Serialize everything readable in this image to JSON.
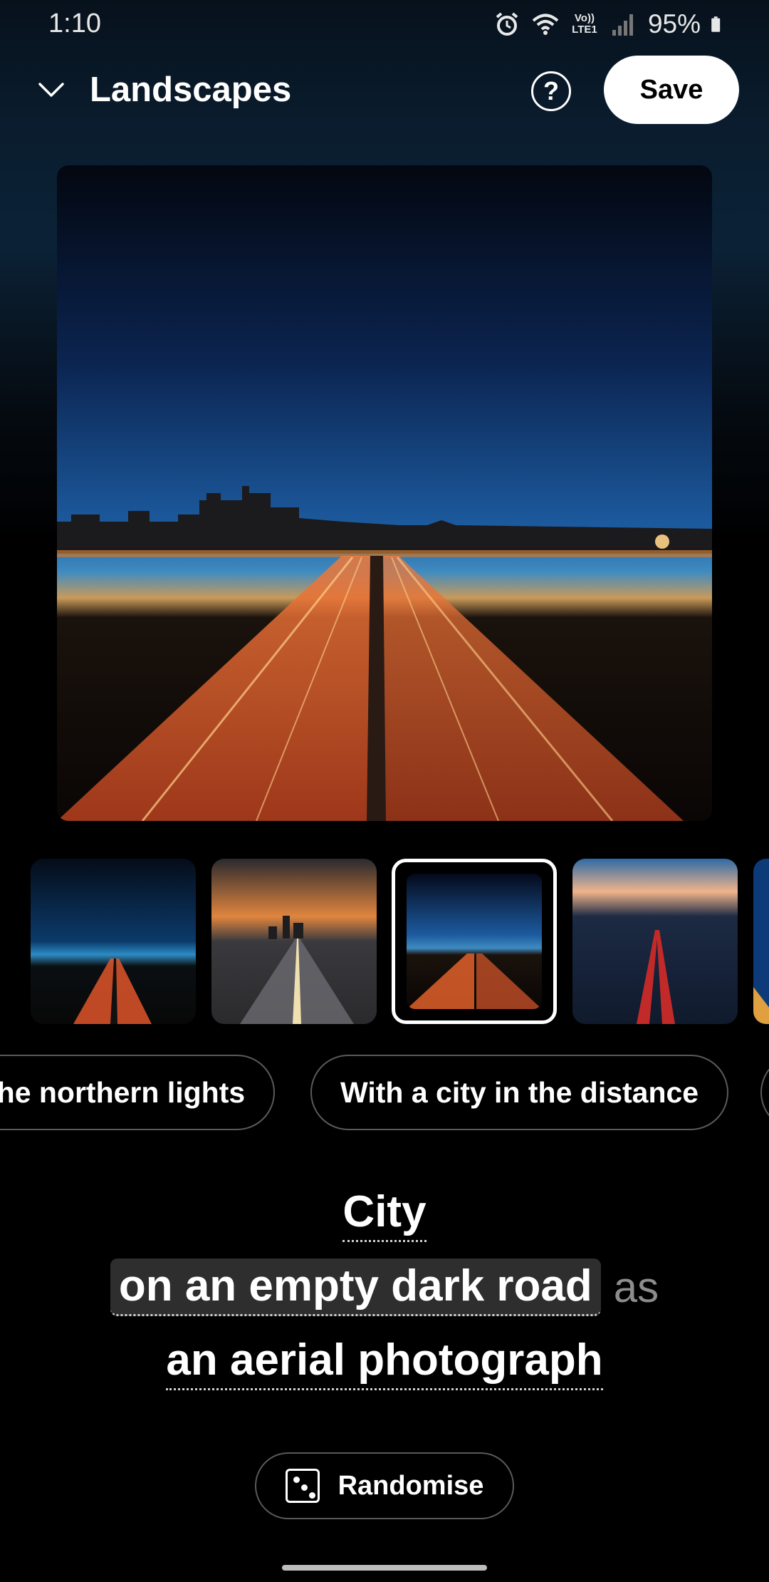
{
  "status_bar": {
    "time": "1:10",
    "network_label": "Vo)) LTE1",
    "battery": "95%",
    "icons": [
      "alarm-icon",
      "wifi-icon",
      "volte-icon",
      "signal-icon",
      "battery-icon"
    ]
  },
  "header": {
    "collapse_icon": "chevron-down-icon",
    "title": "Landscapes",
    "help_label": "?",
    "save_label": "Save"
  },
  "thumbnails": {
    "count_visible": 5,
    "selected_index": 2
  },
  "suggestions": [
    "the northern lights",
    "With a city in the distance"
  ],
  "prompt": {
    "subject": "City",
    "setting": "on an empty dark road",
    "connector": "as",
    "style": "an aerial photograph"
  },
  "randomise": {
    "icon": "dice-icon",
    "label": "Randomise"
  },
  "colors": {
    "background": "#000000",
    "chip_border": "#5a5a5a",
    "highlight": "#2e2e2e",
    "connector_text": "#8c8c8c"
  }
}
